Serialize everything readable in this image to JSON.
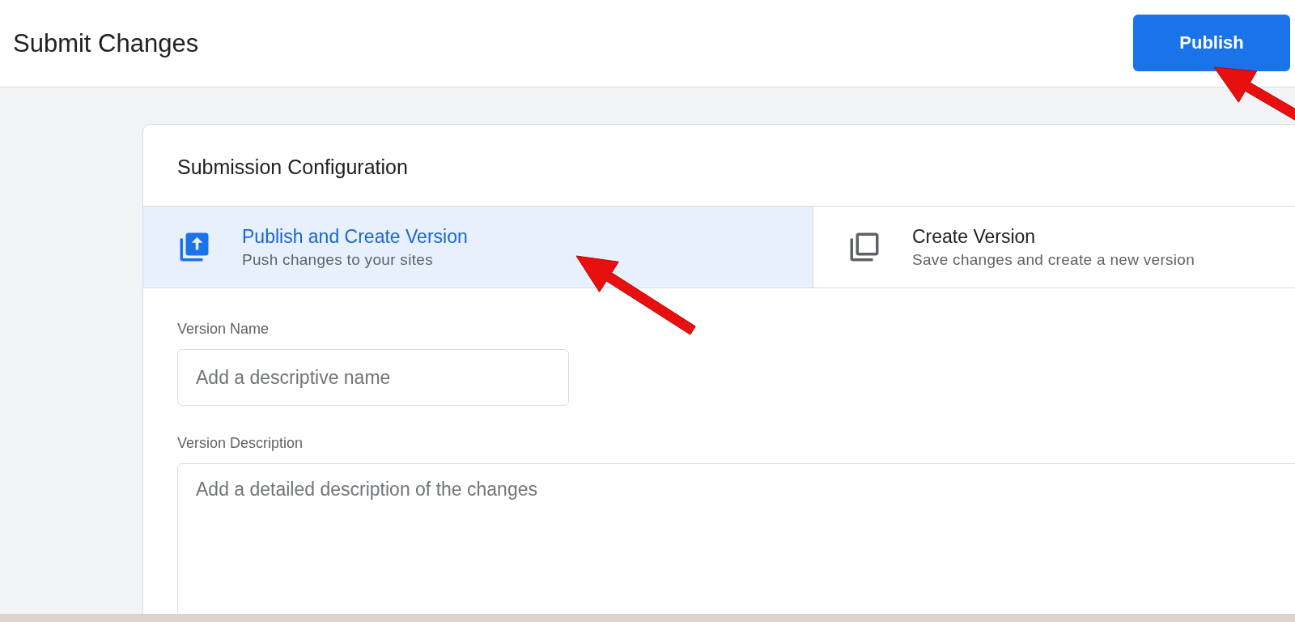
{
  "header": {
    "title": "Submit Changes",
    "publish_button": "Publish"
  },
  "card": {
    "title": "Submission Configuration",
    "options": [
      {
        "kind": "publish",
        "title": "Publish and Create Version",
        "subtitle": "Push changes to your sites",
        "selected": true
      },
      {
        "kind": "version",
        "title": "Create Version",
        "subtitle": "Save changes and create a new version",
        "selected": false
      }
    ],
    "fields": [
      {
        "kind": "input",
        "label": "Version Name",
        "placeholder": "Add a descriptive name"
      },
      {
        "kind": "textarea",
        "label": "Version Description",
        "placeholder": "Add a detailed description of the changes"
      }
    ]
  }
}
